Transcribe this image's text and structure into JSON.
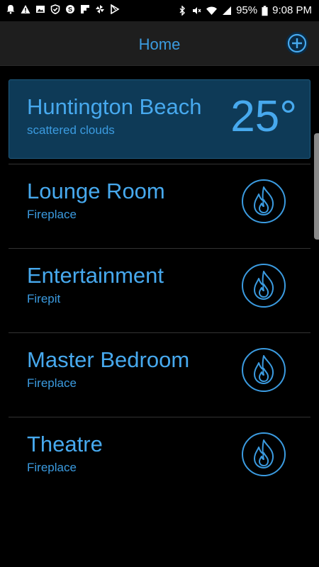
{
  "status_bar": {
    "battery": "95%",
    "time": "9:08 PM"
  },
  "header": {
    "title": "Home",
    "add_icon": "plus-circle-icon"
  },
  "weather": {
    "city": "Huntington Beach",
    "condition": "scattered clouds",
    "temperature": "25°"
  },
  "rooms": [
    {
      "name": "Lounge Room",
      "type": "Fireplace",
      "icon": "flame-icon"
    },
    {
      "name": "Entertainment",
      "type": "Firepit",
      "icon": "flame-icon"
    },
    {
      "name": "Master Bedroom",
      "type": "Fireplace",
      "icon": "flame-icon"
    },
    {
      "name": "Theatre",
      "type": "Fireplace",
      "icon": "flame-icon"
    }
  ],
  "colors": {
    "accent": "#47a9ee",
    "card_bg": "#0e3a57",
    "appbar_bg": "#1e1e1e"
  }
}
